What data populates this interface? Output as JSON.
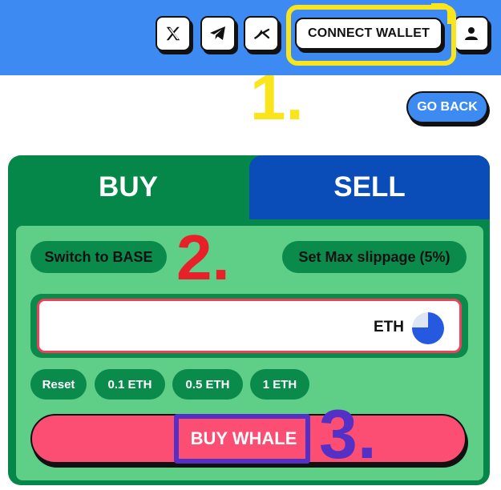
{
  "header": {
    "social_buttons": [
      {
        "icon": "x-logo-icon",
        "label": "X"
      },
      {
        "icon": "telegram-icon",
        "label": "Telegram"
      },
      {
        "icon": "dex-icon",
        "label": "DEX"
      }
    ],
    "connect_wallet_label": "CONNECT WALLET",
    "account_icon": "user-icon",
    "background_color": "#3d8bf2"
  },
  "nav": {
    "go_back_label": "GO BACK"
  },
  "trade": {
    "tabs": [
      {
        "label": "BUY",
        "active": true,
        "color": "#06874a"
      },
      {
        "label": "SELL",
        "active": false,
        "color": "#0b4db8"
      }
    ],
    "switch_network_label": "Switch to BASE",
    "max_slippage_label": "Set Max slippage (5%)",
    "amount": {
      "value": "",
      "placeholder": "",
      "token": "ETH",
      "token_icon": "base-eth-icon"
    },
    "presets": [
      "Reset",
      "0.1 ETH",
      "0.5 ETH",
      "1 ETH"
    ],
    "buy_button_label": "BUY WHALE",
    "buy_button_color": "#fc4d73"
  },
  "annotations": {
    "step1": "1.",
    "step2": "2.",
    "step3": "3.",
    "colors": {
      "step1": "#fae51c",
      "step2": "#e8202a",
      "step3": "#5530c7"
    }
  }
}
